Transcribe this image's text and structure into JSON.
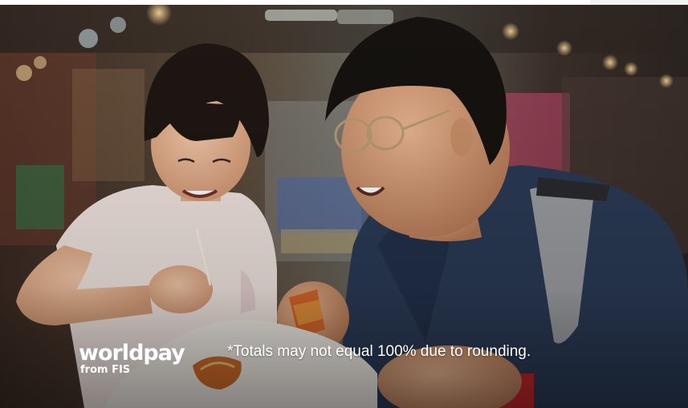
{
  "hero": {
    "image_description_icon": "photo-icon",
    "brand": {
      "name": "worldpay",
      "sub": "from FIS"
    },
    "footnote": "*Totals may not equal 100% due to rounding."
  },
  "colors": {
    "background": "#ffffff",
    "brand_text": "#ffffff",
    "footnote_text": "#ffffff",
    "jacket": "#2a3a55",
    "shirt": "#efe3df"
  }
}
